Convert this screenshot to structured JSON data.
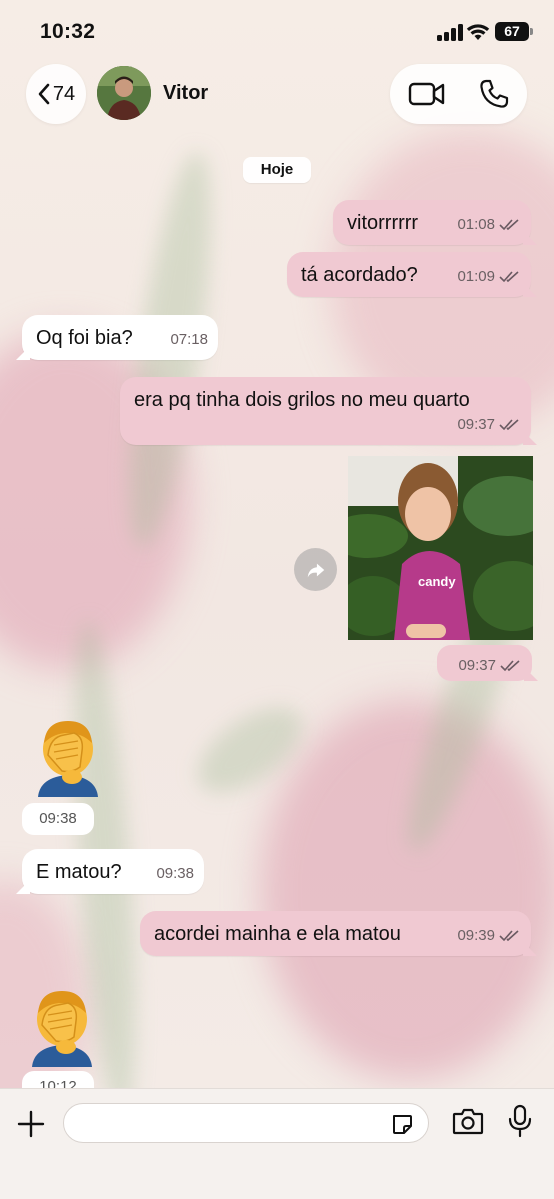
{
  "status_bar": {
    "time": "10:32",
    "battery": "67"
  },
  "header": {
    "back_count": "74",
    "contact_name": "Vitor"
  },
  "date_chip": "Hoje",
  "messages": [
    {
      "direction": "out",
      "text": "vitorrrrrr",
      "time": "01:08",
      "status": "read"
    },
    {
      "direction": "out",
      "text": "tá acordado?",
      "time": "01:09",
      "status": "read"
    },
    {
      "direction": "in",
      "text": "Oq foi bia?",
      "time": "07:18"
    },
    {
      "direction": "out",
      "text": "era pq tinha dois grilos no meu quarto",
      "time": "09:37",
      "status": "read"
    },
    {
      "direction": "out",
      "type": "photo",
      "time": "09:37",
      "status": "read",
      "photo_text": "candy"
    },
    {
      "direction": "in",
      "type": "emoji",
      "emoji": "facepalm",
      "time": "09:38"
    },
    {
      "direction": "in",
      "text": "E matou?",
      "time": "09:38"
    },
    {
      "direction": "out",
      "text": "acordei mainha e ela matou",
      "time": "09:39",
      "status": "read"
    },
    {
      "direction": "in",
      "type": "emoji",
      "emoji": "facepalm",
      "time": "10:12"
    }
  ],
  "composer": {
    "placeholder": ""
  },
  "colors": {
    "outgoing_bubble": "#f0c9d2",
    "incoming_bubble": "#ffffff",
    "tick": "#6a5a62"
  },
  "icons": [
    "chevron-left-icon",
    "video-icon",
    "phone-icon",
    "forward-icon",
    "plus-icon",
    "sticker-icon",
    "camera-icon",
    "mic-icon"
  ]
}
